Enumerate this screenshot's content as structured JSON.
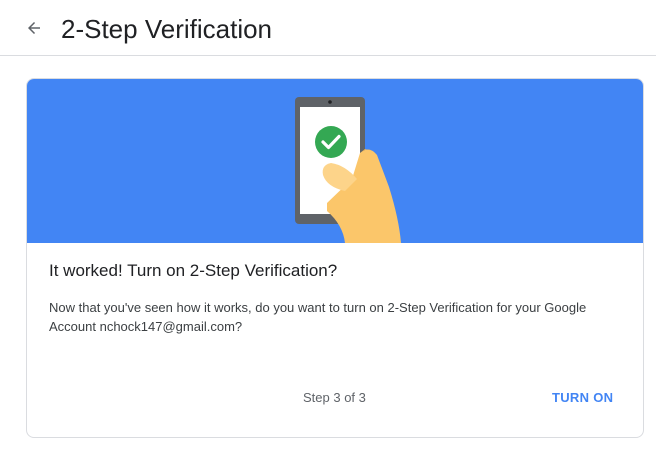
{
  "header": {
    "back_icon": "arrow-back-icon",
    "title": "2-Step Verification"
  },
  "card": {
    "banner": {
      "background_color": "#4285f4",
      "illustration": "hand-holding-phone-with-checkmark",
      "check_color": "#34a853"
    },
    "heading": "It worked! Turn on 2-Step Verification?",
    "body": "Now that you've seen how it works, do you want to turn on 2-Step Verification for your Google Account nchock147@gmail.com?",
    "step_label": "Step 3 of 3",
    "turn_on_label": "TURN ON"
  },
  "colors": {
    "accent": "#4285f4",
    "divider": "#dadce0"
  }
}
